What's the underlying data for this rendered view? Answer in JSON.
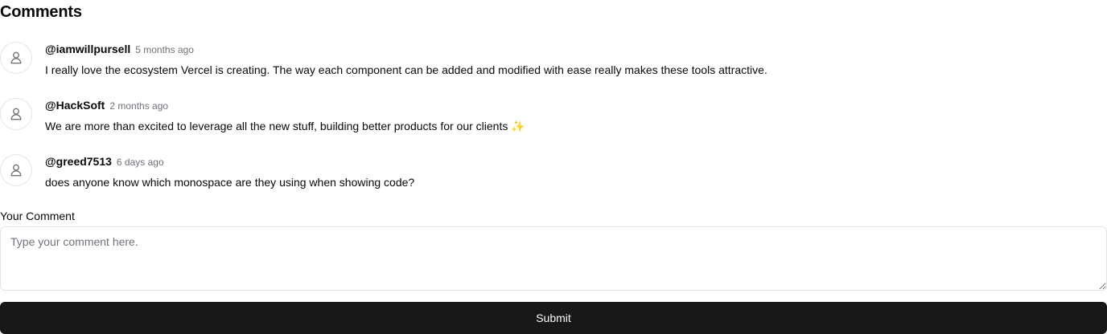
{
  "section": {
    "title": "Comments"
  },
  "comments": [
    {
      "author": "@iamwillpursell",
      "time": "5 months ago",
      "text": "I really love the ecosystem Vercel is creating. The way each component can be added and modified with ease really makes these tools attractive."
    },
    {
      "author": "@HackSoft",
      "time": "2 months ago",
      "text": "We are more than excited to leverage all the new stuff, building better products for our clients ✨"
    },
    {
      "author": "@greed7513",
      "time": "6 days ago",
      "text": "does anyone know which monospace are they using when showing code?"
    }
  ],
  "form": {
    "label": "Your Comment",
    "value": "",
    "placeholder": "Type your comment here.",
    "submit_label": "Submit"
  },
  "colors": {
    "primary": "#18181b",
    "muted_text": "#71717a",
    "border": "#e4e4e7"
  },
  "icons": {
    "avatar": "user-icon"
  }
}
